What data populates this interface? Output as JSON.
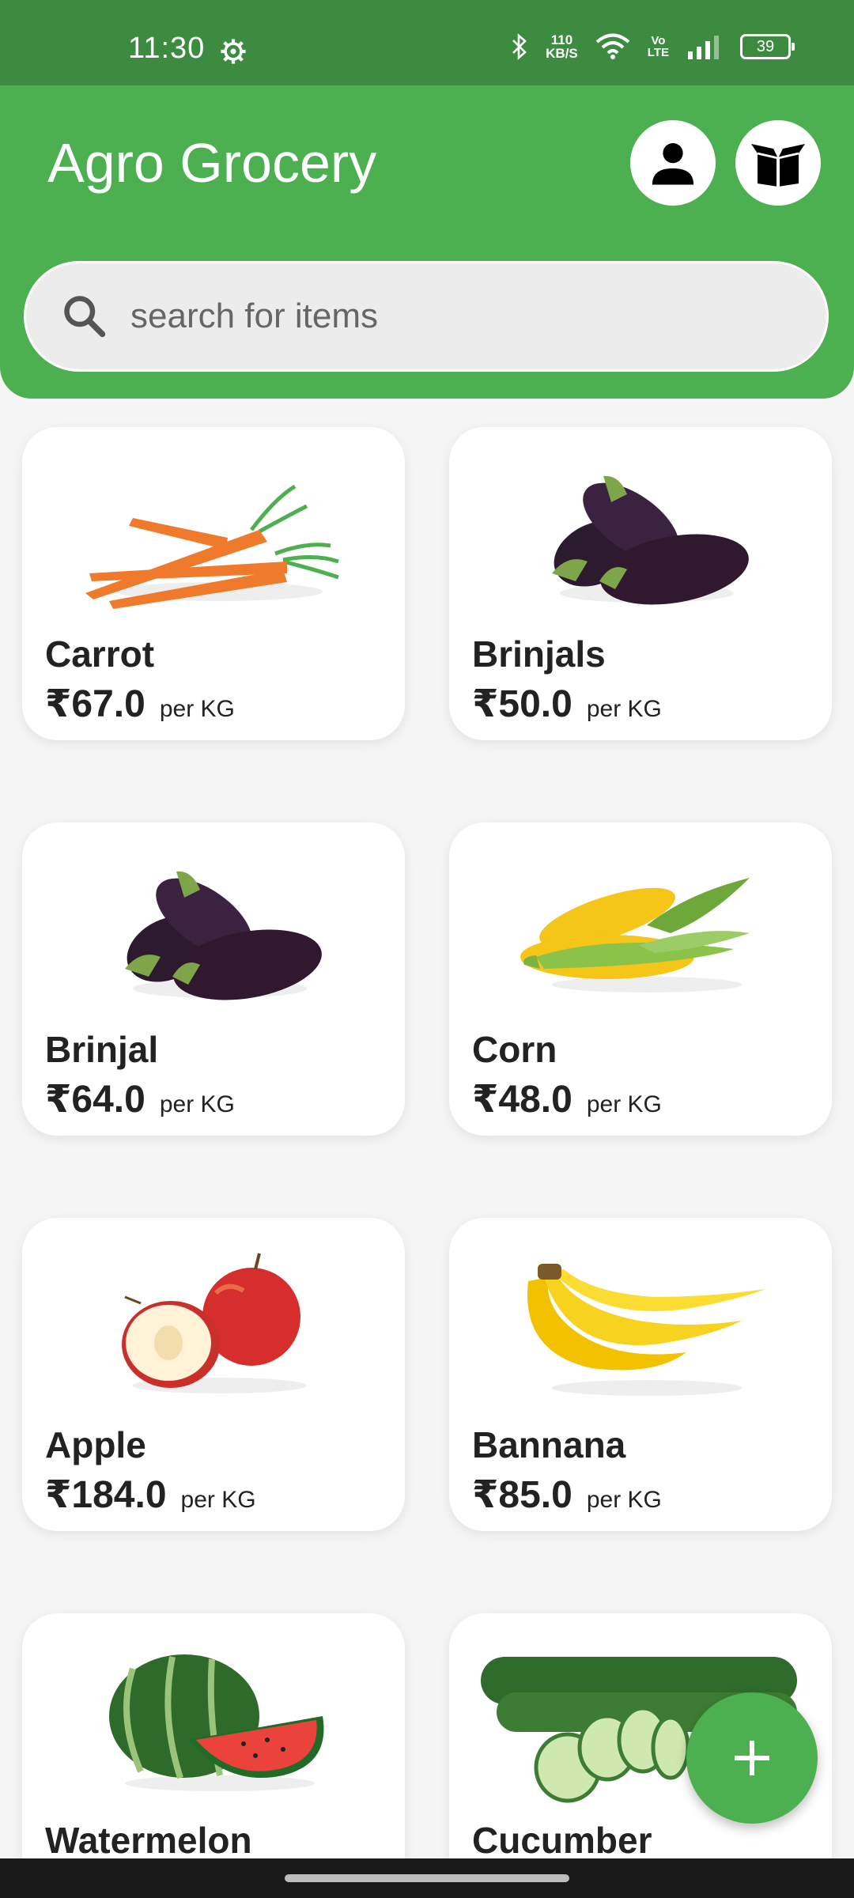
{
  "status_bar": {
    "time": "11:30",
    "net_speed_value": "110",
    "net_speed_unit": "KB/S",
    "volte_top": "Vo",
    "volte_bottom": "LTE",
    "battery": "39",
    "icons": [
      "gear-icon",
      "bluetooth-icon",
      "wifi-icon",
      "signal-icon",
      "battery-icon"
    ]
  },
  "header": {
    "title": "Agro Grocery",
    "profile_icon": "person-icon",
    "orders_icon": "box-icon",
    "search": {
      "placeholder": "search for items",
      "icon": "search-icon"
    }
  },
  "colors": {
    "primary": "#4caf50",
    "status_bar": "#3d8b40",
    "background": "#f5f5f5",
    "card": "#ffffff"
  },
  "products": [
    {
      "name": "Carrot",
      "price": "₹67.0",
      "unit": "per KG",
      "image": "carrot"
    },
    {
      "name": "Brinjals",
      "price": "₹50.0",
      "unit": "per KG",
      "image": "brinjal"
    },
    {
      "name": "Brinjal",
      "price": "₹64.0",
      "unit": "per KG",
      "image": "brinjal"
    },
    {
      "name": "Corn",
      "price": "₹48.0",
      "unit": "per KG",
      "image": "corn"
    },
    {
      "name": "Apple",
      "price": "₹184.0",
      "unit": "per KG",
      "image": "apple"
    },
    {
      "name": "Bannana",
      "price": "₹85.0",
      "unit": "per KG",
      "image": "banana"
    },
    {
      "name": "Watermelon",
      "price": "",
      "unit": "",
      "image": "watermelon"
    },
    {
      "name": "Cucumber",
      "price": "",
      "unit": "",
      "image": "cucumber"
    }
  ],
  "fab": {
    "icon": "plus-icon"
  }
}
